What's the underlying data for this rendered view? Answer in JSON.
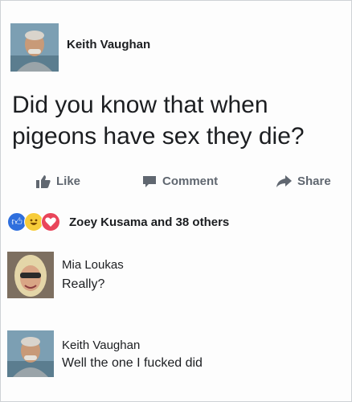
{
  "post": {
    "author": "Keith Vaughan",
    "text_line1": "Did you know that when",
    "text_line2": "pigeons have sex they die?"
  },
  "actions": {
    "like_label": "Like",
    "comment_label": "Comment",
    "share_label": "Share"
  },
  "reactions": {
    "summary_name": "Zoey Kusama",
    "summary_rest": "and 38 others",
    "icons": [
      "like-icon",
      "haha-icon",
      "love-icon"
    ]
  },
  "comments": [
    {
      "author": "Mia Loukas",
      "text": "Really?"
    },
    {
      "author": "Keith Vaughan",
      "text": "Well the one I fucked did"
    }
  ],
  "colors": {
    "text": "#1c1e21",
    "action_gray": "#606770",
    "like_blue": "#2f6fdd",
    "love_red": "#e9455a",
    "haha_yellow": "#f7cc3a"
  }
}
